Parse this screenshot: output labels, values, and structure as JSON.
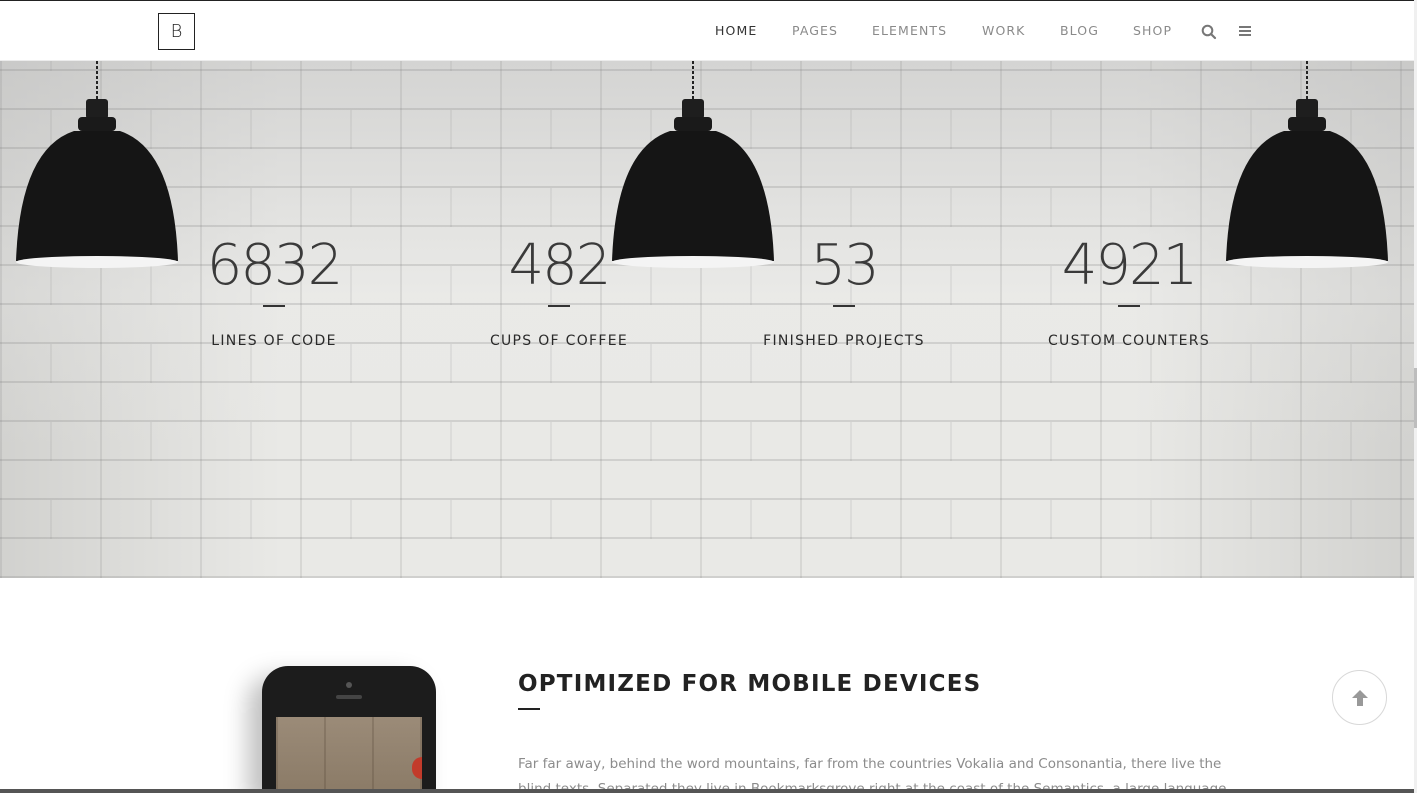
{
  "header": {
    "logo": "B",
    "nav": [
      "HOME",
      "PAGES",
      "ELEMENTS",
      "WORK",
      "BLOG",
      "SHOP"
    ],
    "active_index": 0,
    "icons": [
      "search-icon",
      "menu-icon"
    ]
  },
  "counters": [
    {
      "value": "6832",
      "label": "LINES OF CODE"
    },
    {
      "value": "482",
      "label": "CUPS OF COFFEE"
    },
    {
      "value": "53",
      "label": "FINISHED PROJECTS"
    },
    {
      "value": "4921",
      "label": "CUSTOM COUNTERS"
    }
  ],
  "feature": {
    "title": "OPTIMIZED FOR MOBILE DEVICES",
    "body": "Far far away, behind the word mountains, far from the countries Vokalia and Consonantia, there live the blind texts. Separated they live in Bookmarksgrove right at the coast of the Semantics, a large language ocean. A small river"
  },
  "scroll_top": {
    "icon": "arrow-up-icon"
  },
  "colors": {
    "text_dark": "#222222",
    "nav_muted": "#8a8a8a",
    "body_text": "#8c8c8c"
  }
}
